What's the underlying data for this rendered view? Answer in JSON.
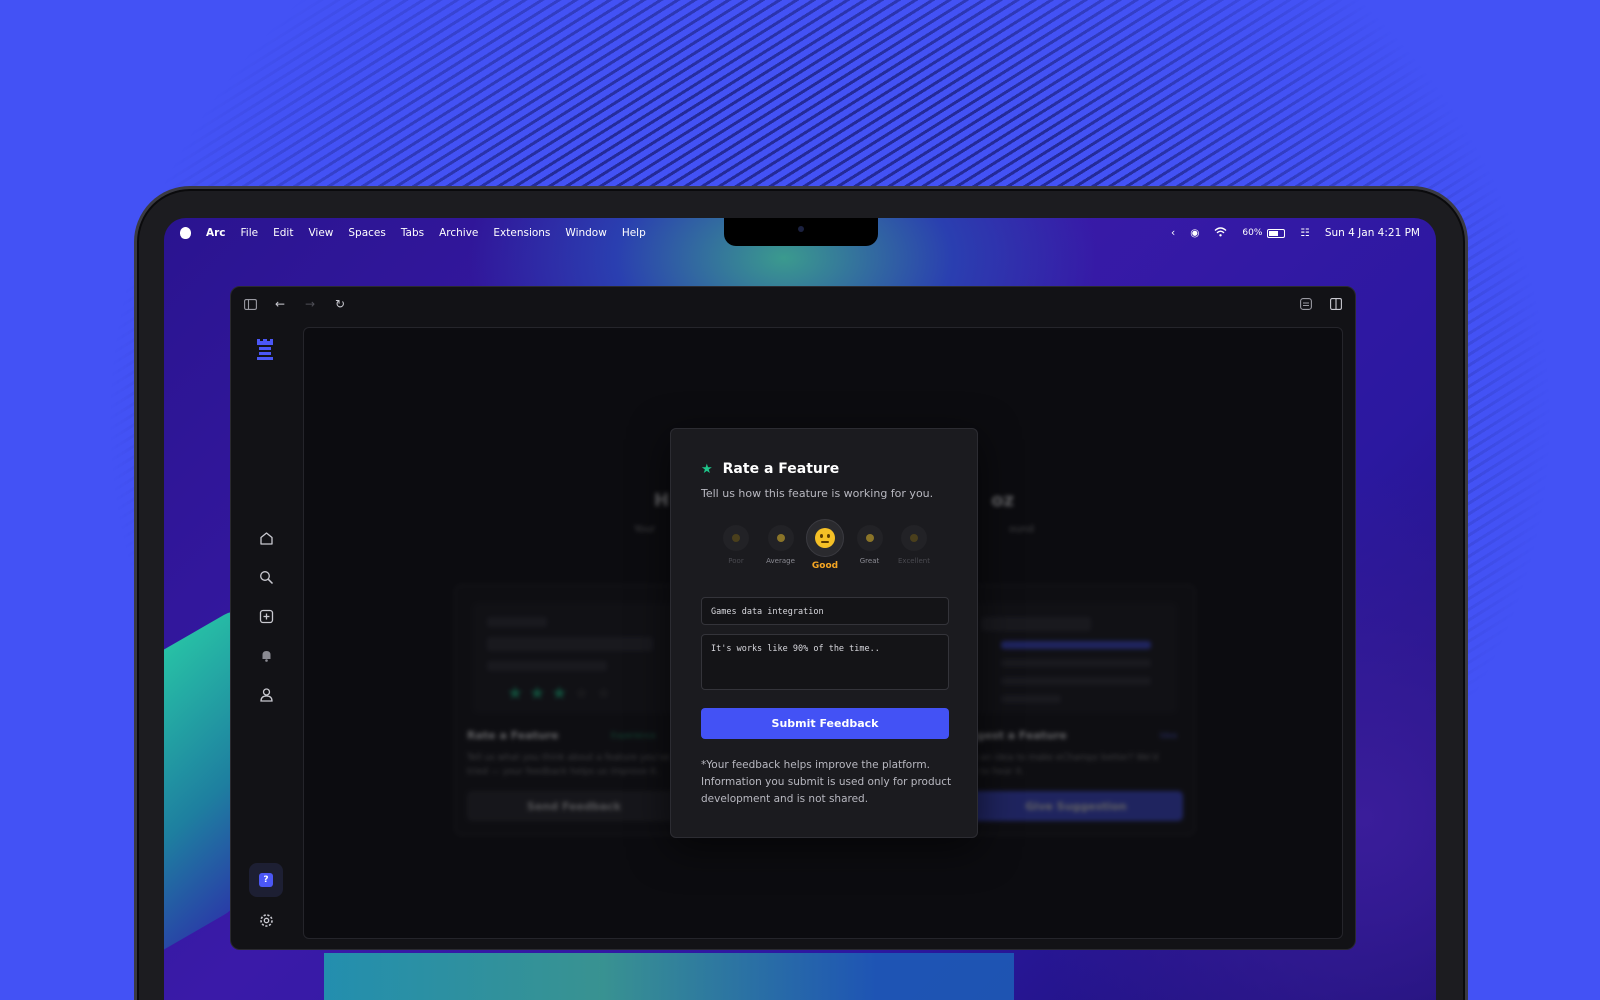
{
  "menubar": {
    "app_name": "Arc",
    "menus": [
      "File",
      "Edit",
      "View",
      "Spaces",
      "Tabs",
      "Archive",
      "Extensions",
      "Window",
      "Help"
    ],
    "battery": "60%",
    "datetime": "Sun 4 Jan  4:21 PM"
  },
  "background_page": {
    "heading_start": "H",
    "heading_end": "oz",
    "sub_start": "Your",
    "sub_end": "ound",
    "left_card": {
      "title": "Rate a Feature",
      "tag": "Experience",
      "text": "Tell us what you think about a feature you've tried — your feedback helps us improve it.",
      "button": "Send Feedback"
    },
    "right_card": {
      "title": "uggest a Feature",
      "tag": "Idea",
      "text": "ave an idea to make eChampz better? We'd ove to hear it.",
      "button": "Give Suggestion"
    }
  },
  "modal": {
    "title": "Rate a Feature",
    "subtitle": "Tell us how this feature is working for you.",
    "ratings": [
      {
        "label": "Poor"
      },
      {
        "label": "Average"
      },
      {
        "label": "Good"
      },
      {
        "label": "Great"
      },
      {
        "label": "Excellent"
      }
    ],
    "selected_rating": "Good",
    "feature_input": "Games data integration",
    "feedback_input": "It's works like 90% of the time..",
    "submit_label": "Submit Feedback",
    "note": "*Your feedback helps improve the platform. Information you submit is used only for product development and is not shared."
  },
  "colors": {
    "accent": "#4352f5",
    "star": "#1fc58a",
    "selected_label": "#f5a623"
  }
}
